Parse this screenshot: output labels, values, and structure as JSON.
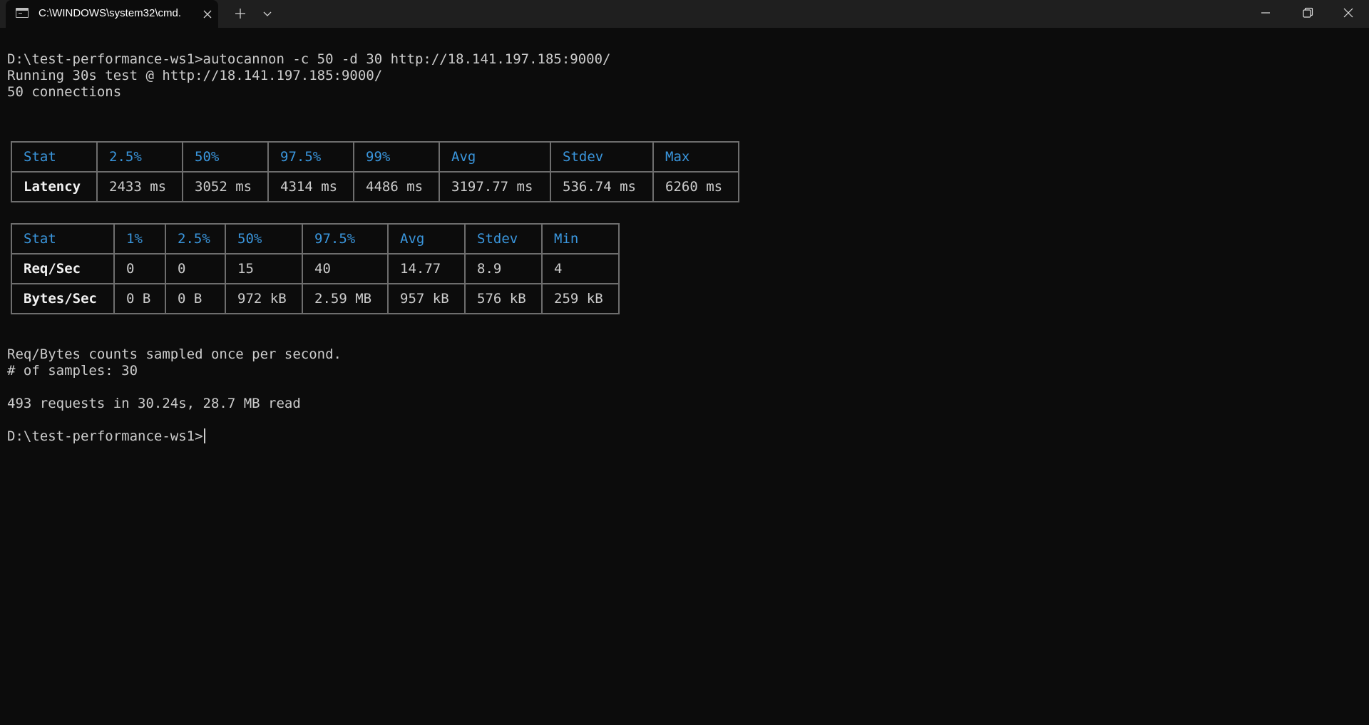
{
  "titlebar": {
    "tab_title": "C:\\WINDOWS\\system32\\cmd.",
    "icons": {
      "tab": "terminal-icon",
      "close_tab": "close-icon",
      "new_tab": "plus-icon",
      "dropdown": "chevron-down-icon",
      "minimize": "minimize-icon",
      "maximize": "restore-icon",
      "close_window": "close-icon"
    }
  },
  "terminal": {
    "command_line": "D:\\test-performance-ws1>autocannon -c 50 -d 30 http://18.141.197.185:9000/",
    "running_line": "Running 30s test @ http://18.141.197.185:9000/",
    "connections_line": "50 connections",
    "latency_table": {
      "headers": [
        "Stat",
        "2.5%",
        "50%",
        "97.5%",
        "99%",
        "Avg",
        "Stdev",
        "Max"
      ],
      "rows": [
        [
          "Latency",
          "2433 ms",
          "3052 ms",
          "4314 ms",
          "4486 ms",
          "3197.77 ms",
          "536.74 ms",
          "6260 ms"
        ]
      ]
    },
    "throughput_table": {
      "headers": [
        "Stat",
        "1%",
        "2.5%",
        "50%",
        "97.5%",
        "Avg",
        "Stdev",
        "Min"
      ],
      "rows": [
        [
          "Req/Sec",
          "0",
          "0",
          "15",
          "40",
          "14.77",
          "8.9",
          "4"
        ],
        [
          "Bytes/Sec",
          "0 B",
          "0 B",
          "972 kB",
          "2.59 MB",
          "957 kB",
          "576 kB",
          "259 kB"
        ]
      ]
    },
    "sampled_line": "Req/Bytes counts sampled once per second.",
    "samples_line": "# of samples: 30",
    "summary_line": "493 requests in 30.24s, 28.7 MB read",
    "prompt_line": "D:\\test-performance-ws1>"
  },
  "colors": {
    "background": "#0c0c0c",
    "titlebar": "#1f1f1f",
    "text": "#cccccc",
    "header_text": "#3a96dd",
    "table_border": "#6e6e6e"
  }
}
